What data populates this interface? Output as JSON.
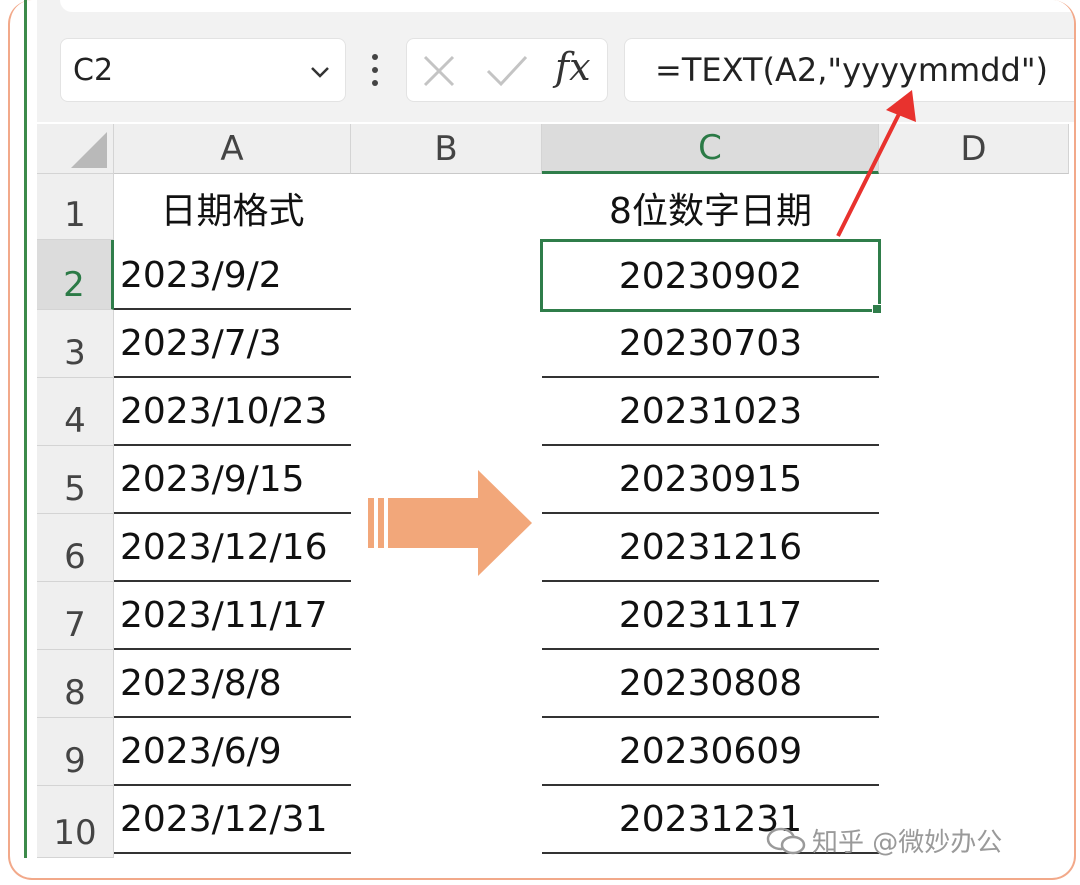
{
  "formula_bar": {
    "name_box": "C2",
    "formula": "=TEXT(A2,\"yyyymmdd\")",
    "fx_label": "fx"
  },
  "columns": [
    "A",
    "B",
    "C",
    "D"
  ],
  "selected_column": "C",
  "rows": [
    "1",
    "2",
    "3",
    "4",
    "5",
    "6",
    "7",
    "8",
    "9",
    "10"
  ],
  "selected_row": "2",
  "headers": {
    "A1": "日期格式",
    "C1": "8位数字日期"
  },
  "column_a": [
    "2023/9/2",
    "2023/7/3",
    "2023/10/23",
    "2023/9/15",
    "2023/12/16",
    "2023/11/17",
    "2023/8/8",
    "2023/6/9",
    "2023/12/31"
  ],
  "column_c": [
    "20230902",
    "20230703",
    "20231023",
    "20230915",
    "20231216",
    "20231117",
    "20230808",
    "20230609",
    "20231231"
  ],
  "watermark": "知乎 @微妙办公",
  "colors": {
    "accent_green": "#2f7d4a",
    "arrow_orange": "#f2a77a",
    "annotation_red": "#e8322e"
  },
  "icons": [
    "chevron-down-icon",
    "more-vert-icon",
    "cancel-icon",
    "confirm-icon",
    "fx-icon",
    "right-arrow-icon",
    "annotation-arrow-icon",
    "wechat-logo-icon"
  ]
}
